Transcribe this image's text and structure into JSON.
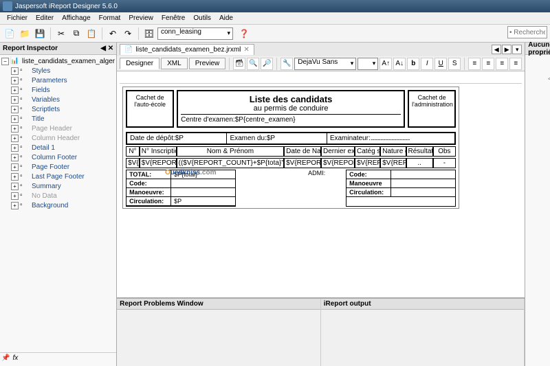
{
  "title": "Jaspersoft iReport Designer 5.6.0",
  "menu": [
    "Fichier",
    "Editer",
    "Affichage",
    "Format",
    "Preview",
    "Fenêtre",
    "Outils",
    "Aide"
  ],
  "datasource": "conn_leasing",
  "search_placeholder": "• Rechercher",
  "inspector": {
    "title": "Report Inspector",
    "root": "liste_candidats_examen_alger",
    "nodes": [
      {
        "label": "Styles",
        "color": "blue"
      },
      {
        "label": "Parameters",
        "color": "blue"
      },
      {
        "label": "Fields",
        "color": "blue"
      },
      {
        "label": "Variables",
        "color": "blue"
      },
      {
        "label": "Scriptlets",
        "color": "blue"
      },
      {
        "label": "Title",
        "color": "blue"
      },
      {
        "label": "Page Header",
        "color": "gray"
      },
      {
        "label": "Column Header",
        "color": "gray"
      },
      {
        "label": "Detail 1",
        "color": "blue"
      },
      {
        "label": "Column Footer",
        "color": "blue"
      },
      {
        "label": "Page Footer",
        "color": "blue"
      },
      {
        "label": "Last Page Footer",
        "color": "blue"
      },
      {
        "label": "Summary",
        "color": "blue"
      },
      {
        "label": "No Data",
        "color": "gray"
      },
      {
        "label": "Background",
        "color": "blue"
      }
    ]
  },
  "tab": {
    "label": "liste_candidats_examen_bez.jrxml"
  },
  "subtabs": {
    "designer": "Designer",
    "xml": "XML",
    "preview": "Preview"
  },
  "font": "DejaVu Sans",
  "right_title": "Aucune propriété",
  "right_placeholder": "<Al",
  "report": {
    "cachet1": "Cachet de l'auto-école",
    "cachet2": "Cachet de l'administration",
    "title": "Liste des candidats",
    "subtitle": "au permis de conduire",
    "centre": "Centre d'examen:$P{centre_examen}",
    "date": "Date de dépôt:$P",
    "examen": "Examen du:$P",
    "examinateur": "Examinateur:",
    "cols": [
      "N°",
      "N° Inscription Année",
      "Nom & Prénom",
      "Date de Naissance",
      "Dernier examen",
      "Catég solicitée",
      "Nature d'examen",
      "Résultats",
      "Obs"
    ],
    "cells": [
      "$V{REPO",
      "$V{REPORT_C",
      "(($V{REPORT_COUNT}+$P{tota}\">\"$F{NOM concat(\" \"+$F {PRENOM})(\"\"))",
      "$V{REPORT_COU",
      "$V{REPORT_COU",
      "$V{REPORT_C",
      "$V{REPORT_C",
      "..",
      "-"
    ],
    "totals": {
      "left": [
        [
          "TOTAL:",
          "$P{total}"
        ],
        [
          "Code:",
          ""
        ],
        [
          "Manoeuvre:",
          ""
        ],
        [
          "Circulation:",
          "$P"
        ]
      ],
      "admi": "ADMI:",
      "right": [
        [
          "Code:",
          ""
        ],
        [
          "Manoeuvre",
          ""
        ],
        [
          "Circulation:",
          ""
        ]
      ]
    }
  },
  "bottom": {
    "left": "Report Problems Window",
    "right": "iReport output"
  }
}
